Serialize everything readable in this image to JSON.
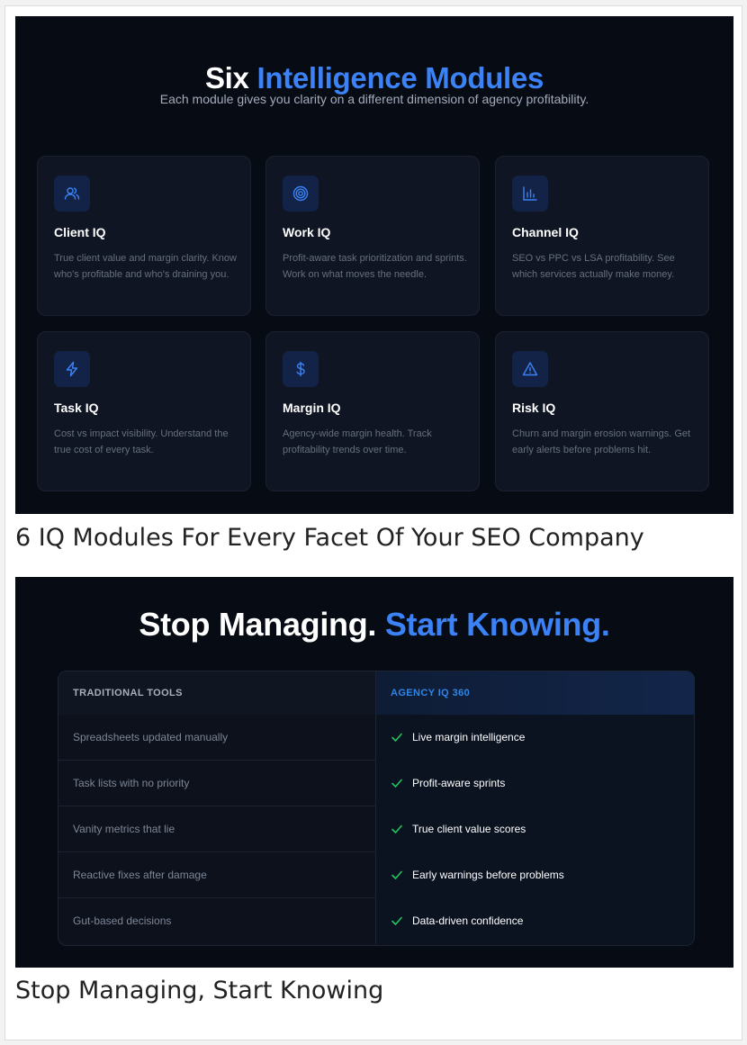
{
  "modules_panel": {
    "title_lead": "Six",
    "title_accent": "Intelligence Modules",
    "subtitle": "Each module gives you clarity on a different dimension of agency profitability.",
    "cards": [
      {
        "name": "Client IQ",
        "icon": "users-icon",
        "desc": "True client value and margin clarity. Know who's profitable and who's draining you."
      },
      {
        "name": "Work IQ",
        "icon": "target-icon",
        "desc": "Profit-aware task prioritization and sprints. Work on what moves the needle."
      },
      {
        "name": "Channel IQ",
        "icon": "bar-chart-icon",
        "desc": "SEO vs PPC vs LSA profitability. See which services actually make money."
      },
      {
        "name": "Task IQ",
        "icon": "lightning-icon",
        "desc": "Cost vs impact visibility. Understand the true cost of every task."
      },
      {
        "name": "Margin IQ",
        "icon": "dollar-icon",
        "desc": "Agency-wide margin health. Track profitability trends over time."
      },
      {
        "name": "Risk IQ",
        "icon": "warning-icon",
        "desc": "Churn and margin erosion warnings. Get early alerts before problems hit."
      }
    ]
  },
  "caption1": "6 IQ Modules For Every Facet Of Your SEO Company",
  "compare_panel": {
    "title_lead": "Stop Managing.",
    "title_accent": "Start Knowing.",
    "col_left": "TRADITIONAL TOOLS",
    "col_right": "AGENCY IQ 360",
    "rows": [
      {
        "left": "Spreadsheets updated manually",
        "right": "Live margin intelligence"
      },
      {
        "left": "Task lists with no priority",
        "right": "Profit-aware sprints"
      },
      {
        "left": "Vanity metrics that lie",
        "right": "True client value scores"
      },
      {
        "left": "Reactive fixes after damage",
        "right": "Early warnings before problems"
      },
      {
        "left": "Gut-based decisions",
        "right": "Data-driven confidence"
      }
    ]
  },
  "caption2": "Stop Managing, Start Knowing",
  "colors": {
    "accent": "#3b82f6",
    "background": "#070b13",
    "check": "#22c55e"
  }
}
